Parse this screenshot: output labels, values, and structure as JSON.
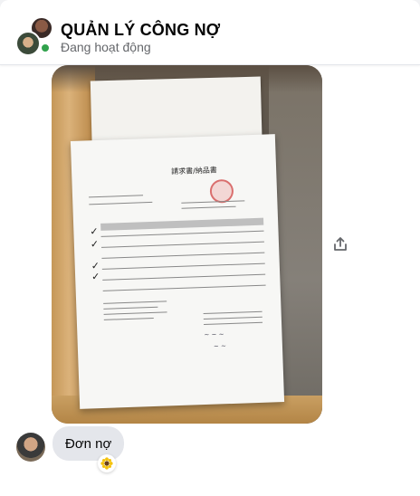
{
  "header": {
    "title": "QUẢN LÝ CÔNG NỢ",
    "status": "Đang hoạt động",
    "online_color": "#31a24c"
  },
  "attachment": {
    "type": "photo",
    "document": {
      "title": "請求書/納品書",
      "rows_checked": 4
    }
  },
  "actions": {
    "share_icon": "share-icon"
  },
  "messages": [
    {
      "text": "Đơn nợ",
      "reaction": "sunflower"
    }
  ],
  "colors": {
    "bubble": "#e4e6eb",
    "text": "#050505",
    "secondary_text": "#65676b"
  }
}
